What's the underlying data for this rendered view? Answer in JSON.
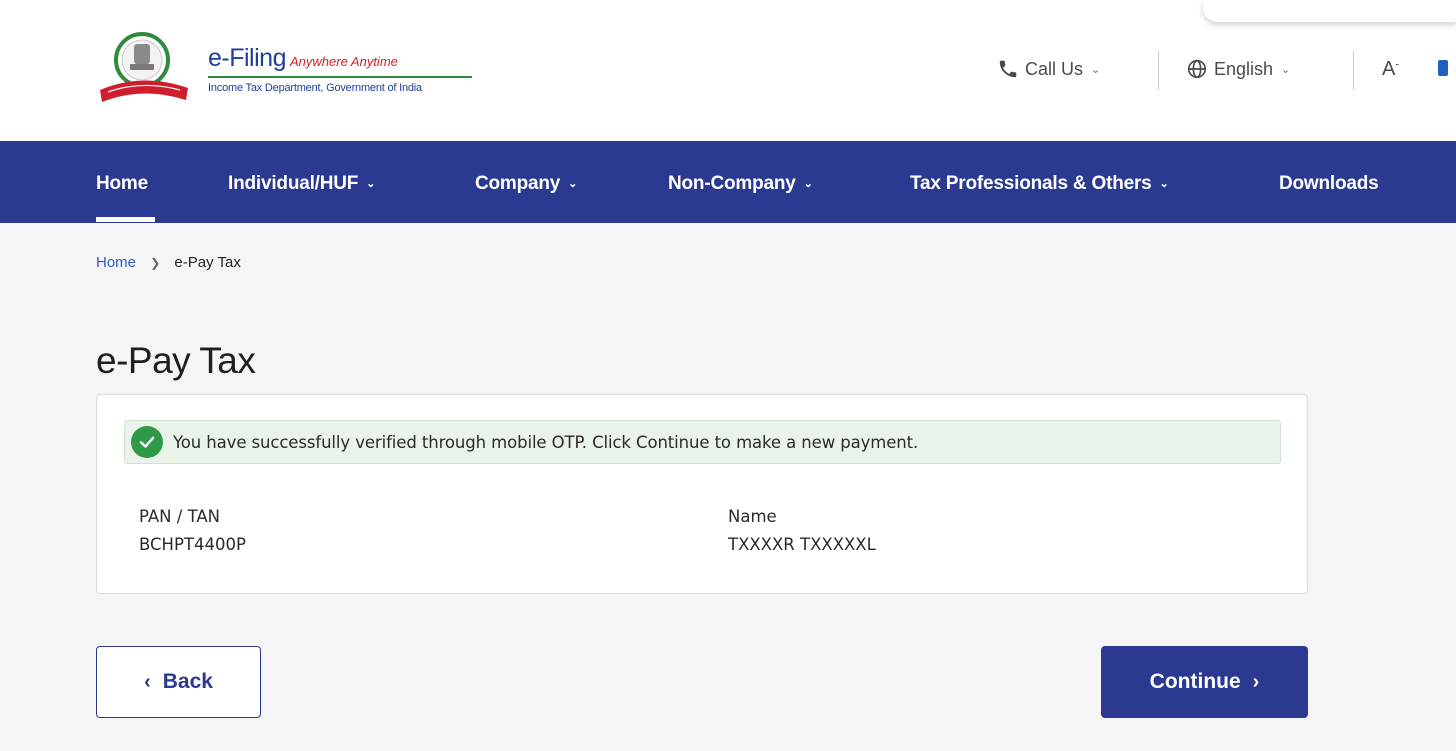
{
  "header": {
    "logo_title": "e-Filing",
    "logo_tagline": "Anywhere Anytime",
    "logo_subtitle": "Income Tax Department, Government of India",
    "call_us": "Call Us",
    "language": "English",
    "font_size_glyph": "A",
    "font_size_sup": "-"
  },
  "nav": {
    "items": [
      {
        "label": "Home",
        "active": true,
        "dropdown": false
      },
      {
        "label": "Individual/HUF",
        "dropdown": true
      },
      {
        "label": "Company",
        "dropdown": true
      },
      {
        "label": "Non-Company",
        "dropdown": true
      },
      {
        "label": "Tax Professionals & Others",
        "dropdown": true
      },
      {
        "label": "Downloads",
        "dropdown": false
      }
    ]
  },
  "breadcrumb": {
    "home": "Home",
    "current": "e-Pay Tax"
  },
  "page": {
    "title": "e-Pay Tax"
  },
  "card": {
    "alert_text": "You have successfully verified through mobile OTP. Click Continue to make a new payment.",
    "pan_label": "PAN / TAN",
    "pan_value": "BCHPT4400P",
    "name_label": "Name",
    "name_value": "TXXXXR TXXXXXL"
  },
  "buttons": {
    "back": "Back",
    "continue": "Continue"
  },
  "colors": {
    "nav_bg": "#2b3990",
    "primary": "#2b3990",
    "success": "#2e9a48",
    "alert_bg": "#eaf3ea",
    "link": "#2b5cc8",
    "page_bg": "#f5f5f7"
  },
  "icons": {
    "emblem": "national-emblem-icon",
    "phone": "phone-icon",
    "globe": "globe-icon",
    "check": "check-circle-icon",
    "chevron_down": "chevron-down-icon",
    "chevron_left": "chevron-left-icon",
    "chevron_right": "chevron-right-icon"
  }
}
